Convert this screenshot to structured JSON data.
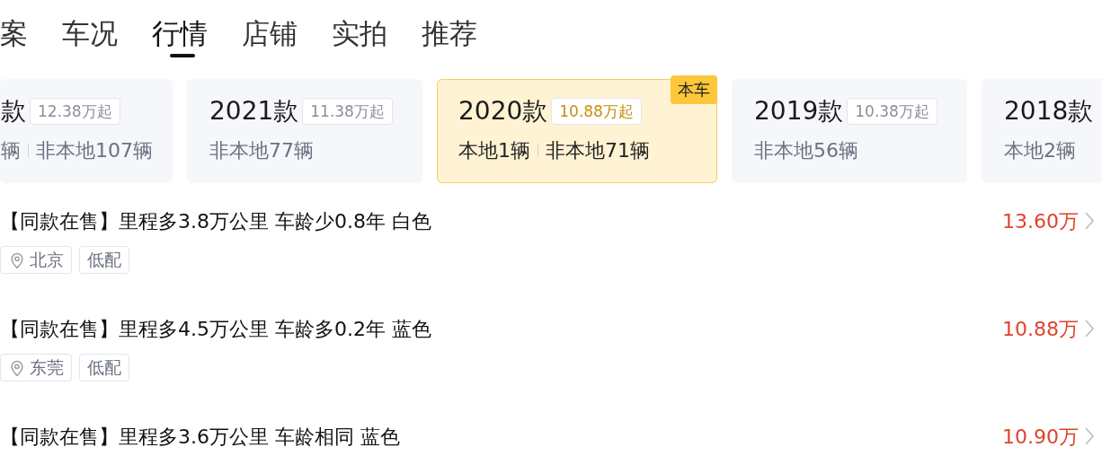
{
  "tabs": [
    {
      "label": "案",
      "selected": false
    },
    {
      "label": "车况",
      "selected": false
    },
    {
      "label": "行情",
      "selected": true
    },
    {
      "label": "店铺",
      "selected": false
    },
    {
      "label": "实拍",
      "selected": false
    },
    {
      "label": "推荐",
      "selected": false
    }
  ],
  "models": [
    {
      "year": "款",
      "price_from": "12.38万起",
      "counts": [
        "辆",
        "非本地107辆"
      ],
      "selected": false,
      "cut": true
    },
    {
      "year": "2021款",
      "price_from": "11.38万起",
      "counts": [
        "非本地77辆"
      ],
      "selected": false
    },
    {
      "year": "2020款",
      "price_from": "10.88万起",
      "counts": [
        "本地1辆",
        "非本地71辆"
      ],
      "selected": true,
      "tag": "本车"
    },
    {
      "year": "2019款",
      "price_from": "10.38万起",
      "counts": [
        "非本地56辆"
      ],
      "selected": false
    },
    {
      "year": "2018款",
      "counts": [
        "本地2辆"
      ],
      "selected": false
    }
  ],
  "listings": [
    {
      "title": "【同款在售】里程多3.8万公里 车龄少0.8年 白色",
      "price": "13.60万",
      "location": "北京",
      "tags": [
        "低配"
      ]
    },
    {
      "title": "【同款在售】里程多4.5万公里 车龄多0.2年 蓝色",
      "price": "10.88万",
      "location": "东莞",
      "tags": [
        "低配"
      ]
    },
    {
      "title": "【同款在售】里程多3.6万公里 车龄相同 蓝色",
      "price": "10.90万"
    }
  ]
}
